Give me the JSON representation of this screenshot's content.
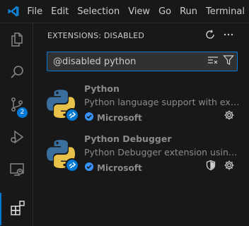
{
  "titlebar": {
    "app_icon": "vscode-logo-icon",
    "menu": [
      "File",
      "Edit",
      "Selection",
      "View",
      "Go",
      "Run",
      "Terminal"
    ]
  },
  "activity_bar": {
    "items": [
      {
        "icon": "files-icon",
        "label": "Explorer"
      },
      {
        "icon": "search-icon",
        "label": "Search"
      },
      {
        "icon": "source-control-icon",
        "label": "Source Control",
        "badge": "2"
      },
      {
        "icon": "run-debug-icon",
        "label": "Run and Debug"
      },
      {
        "icon": "remote-explorer-icon",
        "label": "Remote Explorer"
      },
      {
        "icon": "extensions-icon",
        "label": "Extensions",
        "active": true
      }
    ]
  },
  "sidebar": {
    "title": "EXTENSIONS: DISABLED",
    "actions": {
      "refresh_icon": "refresh-icon",
      "more_icon": "more-actions-icon"
    },
    "search": {
      "value": "@disabled python",
      "clear_icon": "clear-filter-icon",
      "filter_icon": "filter-icon"
    }
  },
  "extensions": [
    {
      "name": "Python",
      "description": "Python language support with extension access points",
      "publisher": "Microsoft",
      "verified": true,
      "has_shield": false
    },
    {
      "name": "Python Debugger",
      "description": "Python Debugger extension using debugpy",
      "publisher": "Microsoft",
      "verified": true,
      "has_shield": true
    }
  ],
  "colors": {
    "accent": "#0078d4",
    "background": "#181818",
    "muted_text": "#8b8b8b",
    "python_blue": "#3a6e9c",
    "python_yellow": "#f2c94c"
  }
}
